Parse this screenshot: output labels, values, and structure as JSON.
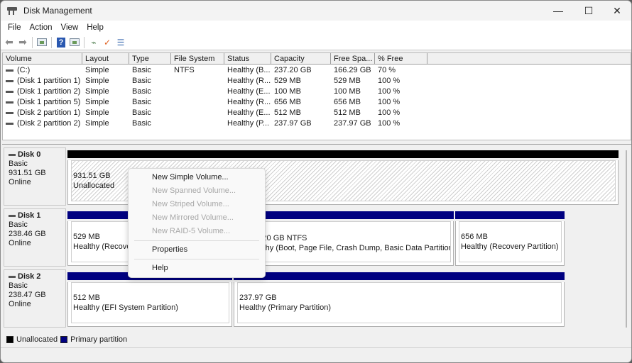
{
  "window": {
    "title": "Disk Management",
    "minimize": "—",
    "maximize": "☐",
    "close": "✕"
  },
  "menu": [
    "File",
    "Action",
    "View",
    "Help"
  ],
  "toolbar": {
    "icons": [
      "back-icon",
      "forward-icon",
      "console-tree-icon",
      "help-icon",
      "action-pane-icon",
      "connect-icon",
      "properties-icon",
      "list-view-icon"
    ]
  },
  "volumes": {
    "columns": [
      "Volume",
      "Layout",
      "Type",
      "File System",
      "Status",
      "Capacity",
      "Free Spa...",
      "% Free"
    ],
    "rows": [
      [
        "(C:)",
        "Simple",
        "Basic",
        "NTFS",
        "Healthy (B...",
        "237.20 GB",
        "166.29 GB",
        "70 %"
      ],
      [
        "(Disk 1 partition 1)",
        "Simple",
        "Basic",
        "",
        "Healthy (R...",
        "529 MB",
        "529 MB",
        "100 %"
      ],
      [
        "(Disk 1 partition 2)",
        "Simple",
        "Basic",
        "",
        "Healthy (E...",
        "100 MB",
        "100 MB",
        "100 %"
      ],
      [
        "(Disk 1 partition 5)",
        "Simple",
        "Basic",
        "",
        "Healthy (R...",
        "656 MB",
        "656 MB",
        "100 %"
      ],
      [
        "(Disk 2 partition 1)",
        "Simple",
        "Basic",
        "",
        "Healthy (E...",
        "512 MB",
        "512 MB",
        "100 %"
      ],
      [
        "(Disk 2 partition 2)",
        "Simple",
        "Basic",
        "",
        "Healthy (P...",
        "237.97 GB",
        "237.97 GB",
        "100 %"
      ]
    ]
  },
  "disks": [
    {
      "name": "Disk 0",
      "type": "Basic",
      "size": "931.51 GB",
      "status": "Online",
      "partitions": [
        {
          "line1": "",
          "line2": "931.51 GB",
          "line3": "Unallocated",
          "kind": "unallocated"
        }
      ]
    },
    {
      "name": "Disk 1",
      "type": "Basic",
      "size": "238.46 GB",
      "status": "Online",
      "partitions": [
        {
          "line1": "",
          "line2": "529 MB",
          "line3": "Healthy (Recovery Partition)",
          "kind": "primary"
        },
        {
          "line1": "(C:)",
          "line2": "237.20 GB NTFS",
          "line3": "Healthy (Boot, Page File, Crash Dump, Basic Data Partition)",
          "kind": "primary"
        },
        {
          "line1": "",
          "line2": "656 MB",
          "line3": "Healthy (Recovery Partition)",
          "kind": "primary"
        }
      ]
    },
    {
      "name": "Disk 2",
      "type": "Basic",
      "size": "238.47 GB",
      "status": "Online",
      "partitions": [
        {
          "line1": "",
          "line2": "512 MB",
          "line3": "Healthy (EFI System Partition)",
          "kind": "primary"
        },
        {
          "line1": "",
          "line2": "237.97 GB",
          "line3": "Healthy (Primary Partition)",
          "kind": "primary"
        }
      ]
    }
  ],
  "legend": [
    {
      "label": "Unallocated",
      "color": "#000000"
    },
    {
      "label": "Primary partition",
      "color": "#000080"
    }
  ],
  "context_menu": {
    "items": [
      {
        "label": "New Simple Volume...",
        "enabled": true
      },
      {
        "label": "New Spanned Volume...",
        "enabled": false
      },
      {
        "label": "New Striped Volume...",
        "enabled": false
      },
      {
        "label": "New Mirrored Volume...",
        "enabled": false
      },
      {
        "label": "New RAID-5 Volume...",
        "enabled": false
      },
      {
        "label": "Properties",
        "enabled": true
      },
      {
        "label": "Help",
        "enabled": true
      }
    ]
  },
  "colors": {
    "primary": "#000080",
    "unallocated": "#000000"
  }
}
